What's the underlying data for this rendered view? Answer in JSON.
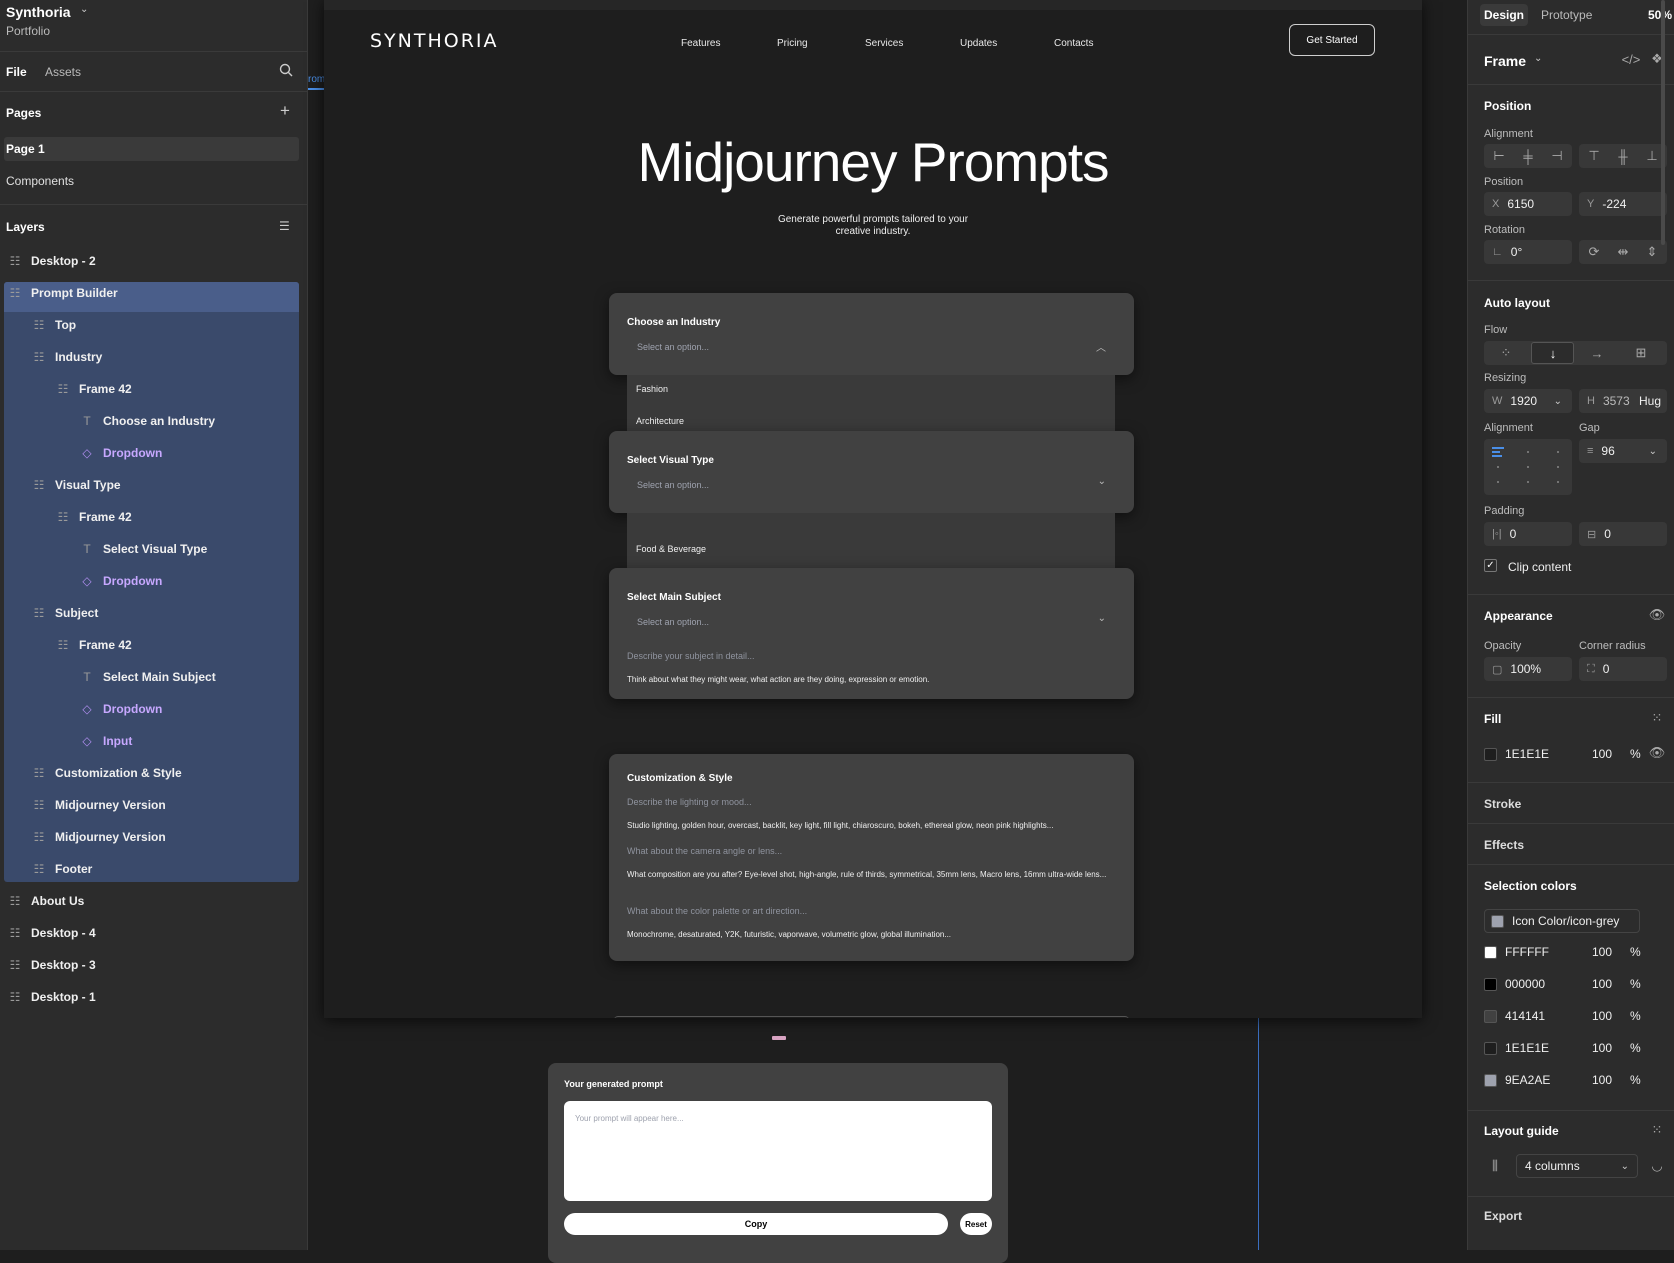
{
  "project": {
    "name": "Synthoria",
    "subtitle": "Portfolio"
  },
  "left_tabs": {
    "file": "File",
    "assets": "Assets"
  },
  "pages_header": "Pages",
  "pages": [
    "Page 1",
    "Components"
  ],
  "layers_header": "Layers",
  "layers": [
    {
      "label": "Desktop - 2",
      "indent": 0,
      "type": "frame"
    },
    {
      "label": "Prompt Builder",
      "indent": 0,
      "type": "frame"
    },
    {
      "label": "Top",
      "indent": 1,
      "type": "frame"
    },
    {
      "label": "Industry",
      "indent": 1,
      "type": "frame"
    },
    {
      "label": "Frame 42",
      "indent": 2,
      "type": "frame"
    },
    {
      "label": "Choose an Industry",
      "indent": 3,
      "type": "text"
    },
    {
      "label": "Dropdown",
      "indent": 3,
      "type": "component"
    },
    {
      "label": "Visual Type",
      "indent": 1,
      "type": "frame"
    },
    {
      "label": "Frame 42",
      "indent": 2,
      "type": "frame"
    },
    {
      "label": "Select Visual Type",
      "indent": 3,
      "type": "text"
    },
    {
      "label": "Dropdown",
      "indent": 3,
      "type": "component"
    },
    {
      "label": "Subject",
      "indent": 1,
      "type": "frame"
    },
    {
      "label": "Frame 42",
      "indent": 2,
      "type": "frame"
    },
    {
      "label": "Select Main Subject",
      "indent": 3,
      "type": "text"
    },
    {
      "label": "Dropdown",
      "indent": 3,
      "type": "component"
    },
    {
      "label": "Input",
      "indent": 3,
      "type": "component"
    },
    {
      "label": "Customization & Style",
      "indent": 1,
      "type": "frame"
    },
    {
      "label": "Midjourney Version",
      "indent": 1,
      "type": "frame"
    },
    {
      "label": "Midjourney Version",
      "indent": 1,
      "type": "frame"
    },
    {
      "label": "Footer",
      "indent": 1,
      "type": "frame"
    },
    {
      "label": "About Us",
      "indent": 0,
      "type": "frame"
    },
    {
      "label": "Desktop - 4",
      "indent": 0,
      "type": "frame"
    },
    {
      "label": "Desktop - 3",
      "indent": 0,
      "type": "frame"
    },
    {
      "label": "Desktop - 1",
      "indent": 0,
      "type": "frame"
    }
  ],
  "canvas_fragment": "rom",
  "site": {
    "logo": "SYNTHORIA",
    "nav": [
      "Features",
      "Pricing",
      "Services",
      "Updates",
      "Contacts"
    ],
    "cta": "Get Started",
    "hero_title": "Midjourney Prompts",
    "hero_sub_1": "Generate powerful prompts tailored to your",
    "hero_sub_2": "creative industry.",
    "industry": {
      "title": "Choose an Industry",
      "placeholder": "Select an option...",
      "options": [
        "Fashion",
        "Architecture",
        "Food & Beverage"
      ]
    },
    "visual": {
      "title": "Select Visual Type",
      "placeholder": "Select an option..."
    },
    "subject": {
      "title": "Select Main Subject",
      "placeholder": "Select an option...",
      "input_placeholder": "Describe your subject in detail...",
      "hint": "Think about what they might wear, what action are they doing, expression or emotion."
    },
    "custom": {
      "title": "Customization & Style",
      "q1": "Describe the lighting or mood...",
      "a1": "Studio lighting, golden hour, overcast, backlit, key light, fill light, chiaroscuro, bokeh, ethereal glow, neon pink highlights...",
      "q2": "What about the camera angle or lens...",
      "a2": "What composition are you after? Eye-level shot, high-angle, rule of thirds, symmetrical, 35mm lens, Macro lens, 16mm ultra-wide lens...",
      "q3": "What about the color palette or art direction...",
      "a3": "Monochrome, desaturated, Y2K, futuristic, vaporwave, volumetric glow, global illumination..."
    },
    "generated": {
      "title": "Your generated prompt",
      "placeholder": "Your prompt will appear here...",
      "copy": "Copy",
      "reset": "Reset"
    }
  },
  "right_tabs": {
    "design": "Design",
    "prototype": "Prototype",
    "zoom": "50%"
  },
  "right": {
    "frame_label": "Frame",
    "position_header": "Position",
    "alignment_label": "Alignment",
    "position_label": "Position",
    "x": "6150",
    "y": "-224",
    "rotation_label": "Rotation",
    "rotation": "0°",
    "autolayout_header": "Auto layout",
    "flow_label": "Flow",
    "resizing_label": "Resizing",
    "w": "1920",
    "h": "3573",
    "h_mode": "Hug",
    "alignment2_label": "Alignment",
    "gap_label": "Gap",
    "gap": "96",
    "padding_label": "Padding",
    "pad_h": "0",
    "pad_v": "0",
    "clip_label": "Clip content",
    "appearance_header": "Appearance",
    "opacity_label": "Opacity",
    "opacity": "100%",
    "radius_label": "Corner radius",
    "radius": "0",
    "fill_header": "Fill",
    "fill_hex": "1E1E1E",
    "fill_pct": "100",
    "stroke_header": "Stroke",
    "effects_header": "Effects",
    "selcolors_header": "Selection colors",
    "icon_color": "Icon Color/icon-grey",
    "colors": [
      {
        "hex": "FFFFFF",
        "pct": "100",
        "swatch": "#ffffff"
      },
      {
        "hex": "000000",
        "pct": "100",
        "swatch": "#000000"
      },
      {
        "hex": "414141",
        "pct": "100",
        "swatch": "#414141"
      },
      {
        "hex": "1E1E1E",
        "pct": "100",
        "swatch": "#1e1e1e"
      },
      {
        "hex": "9EA2AE",
        "pct": "100",
        "swatch": "#9ea2ae"
      }
    ],
    "layout_guide_header": "Layout guide",
    "columns": "4 columns",
    "export_header": "Export"
  }
}
